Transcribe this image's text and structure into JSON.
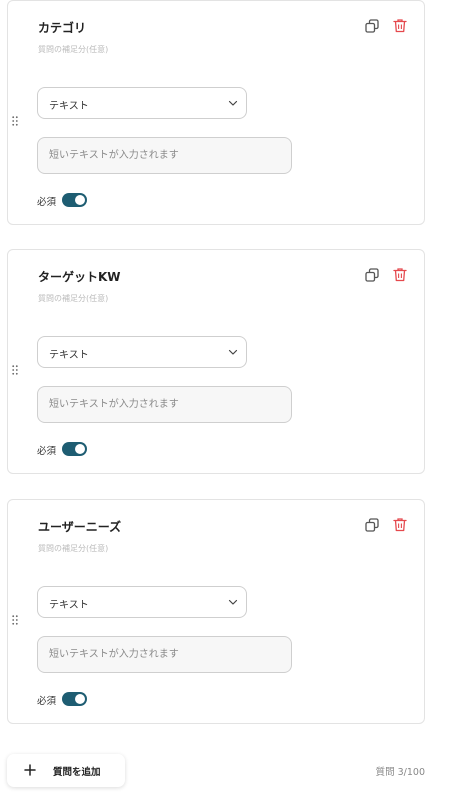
{
  "questions": [
    {
      "title": "カテゴリ",
      "description_placeholder": "質問の補足分(任意)",
      "answer_type": "テキスト",
      "answer_placeholder": "短いテキストが入力されます",
      "required_label": "必須",
      "required": true
    },
    {
      "title": "ターゲットKW",
      "description_placeholder": "質問の補足分(任意)",
      "answer_type": "テキスト",
      "answer_placeholder": "短いテキストが入力されます",
      "required_label": "必須",
      "required": true
    },
    {
      "title": "ユーザーニーズ",
      "description_placeholder": "質問の補足分(任意)",
      "answer_type": "テキスト",
      "answer_placeholder": "短いテキストが入力されます",
      "required_label": "必須",
      "required": true
    }
  ],
  "footer": {
    "add_question_label": "質問を追加",
    "question_count": "質問 3/100"
  },
  "colors": {
    "toggle_on": "#1e5d72",
    "trash_icon": "#e5484d",
    "copy_icon": "#555555",
    "card_border": "#e3e3e3"
  },
  "icons": [
    "duplicate-icon",
    "trash-icon",
    "drag-handle-icon",
    "chevron-down-icon",
    "plus-icon"
  ]
}
